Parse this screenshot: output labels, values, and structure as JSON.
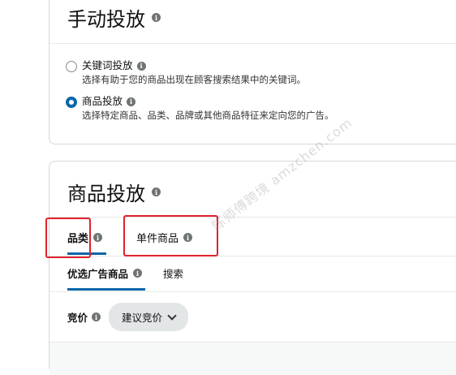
{
  "manual_targeting": {
    "title": "手动投放",
    "options": [
      {
        "label": "关键词投放",
        "description": "选择有助于您的商品出现在顾客搜索结果中的关键词。",
        "checked": false
      },
      {
        "label": "商品投放",
        "description": "选择特定商品、品类、品牌或其他商品特征来定向您的广告。",
        "checked": true
      }
    ]
  },
  "product_targeting": {
    "title": "商品投放",
    "tabs": [
      {
        "label": "品类",
        "active": true
      },
      {
        "label": "单件商品",
        "active": false
      }
    ],
    "subtabs": [
      {
        "label": "优选广告商品",
        "active": true
      },
      {
        "label": "搜索",
        "active": false
      }
    ],
    "bid": {
      "label": "竞价",
      "dropdown_value": "建议竞价"
    }
  },
  "watermark": "陈师傅跨境 amzchen.com",
  "colors": {
    "accent": "#0a66a8",
    "annotation_red": "#e0222c"
  }
}
